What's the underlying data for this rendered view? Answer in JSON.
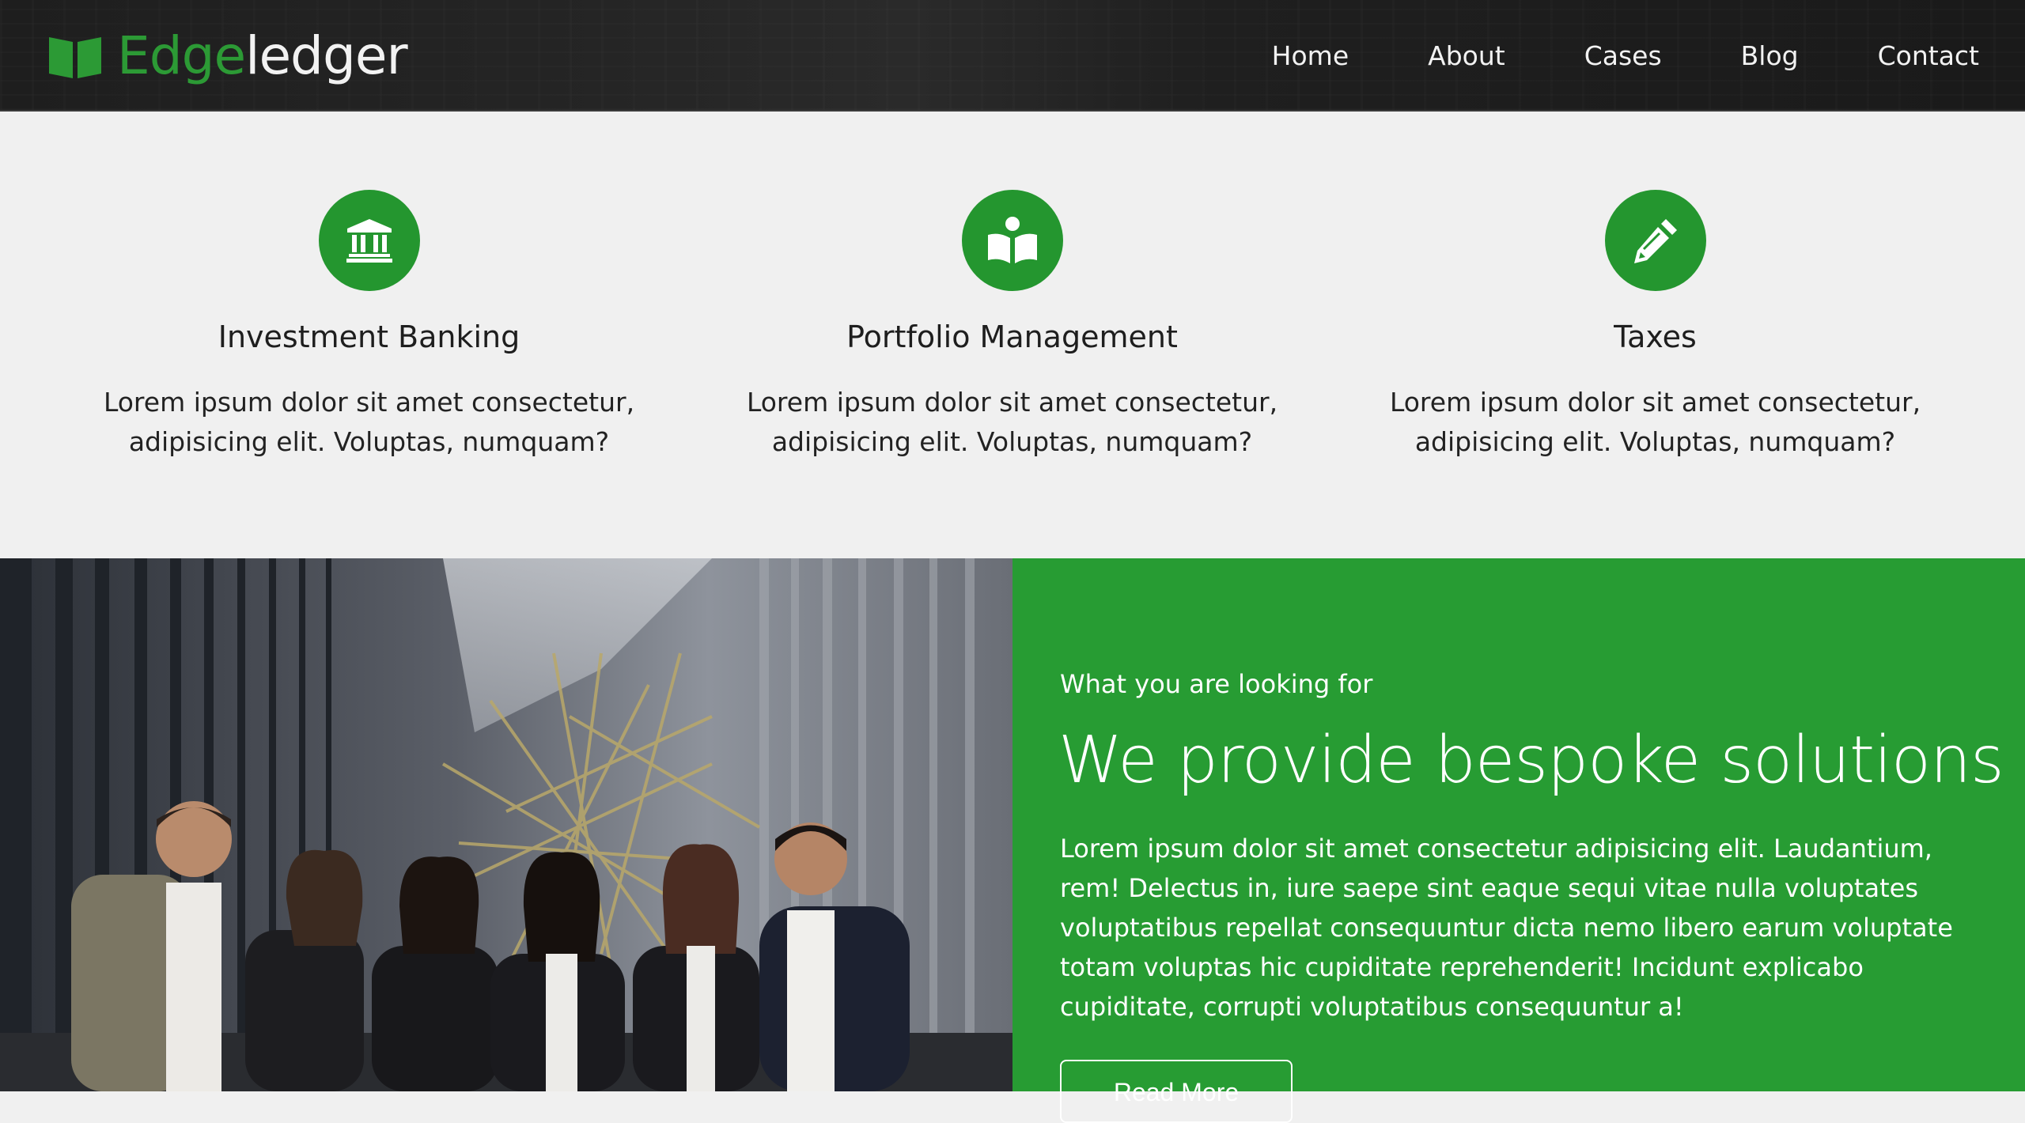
{
  "brand": {
    "name_part1": "Edge",
    "name_part2": "ledger",
    "icon": "open-book-icon",
    "accent_color": "#279c33"
  },
  "nav": {
    "items": [
      "Home",
      "About",
      "Cases",
      "Blog",
      "Contact"
    ]
  },
  "services": [
    {
      "icon": "bank-icon",
      "title": "Investment Banking",
      "description": "Lorem ipsum dolor sit amet consectetur, adipisicing elit. Voluptas, numquam?"
    },
    {
      "icon": "reader-book-icon",
      "title": "Portfolio Management",
      "description": "Lorem ipsum dolor sit amet consectetur, adipisicing elit. Voluptas, numquam?"
    },
    {
      "icon": "pencil-icon",
      "title": "Taxes",
      "description": "Lorem ipsum dolor sit amet consectetur, adipisicing elit. Voluptas, numquam?"
    }
  ],
  "promo": {
    "kicker": "What you are looking for",
    "headline": "We provide bespoke solutions",
    "body": "Lorem ipsum dolor sit amet consectetur adipisicing elit. Laudantium, rem! Delectus in, iure saepe sint eaque sequi vitae nulla voluptates voluptatibus repellat consequuntur dicta nemo libero earum voluptate totam voluptas hic cupiditate reprehenderit! Incidunt explicabo cupiditate, corrupti voluptatibus consequuntur a!",
    "button_label": "Read More"
  },
  "colors": {
    "header_bg": "#1f1f1f",
    "section_bg": "#f0f0f0",
    "green": "#24962f"
  }
}
